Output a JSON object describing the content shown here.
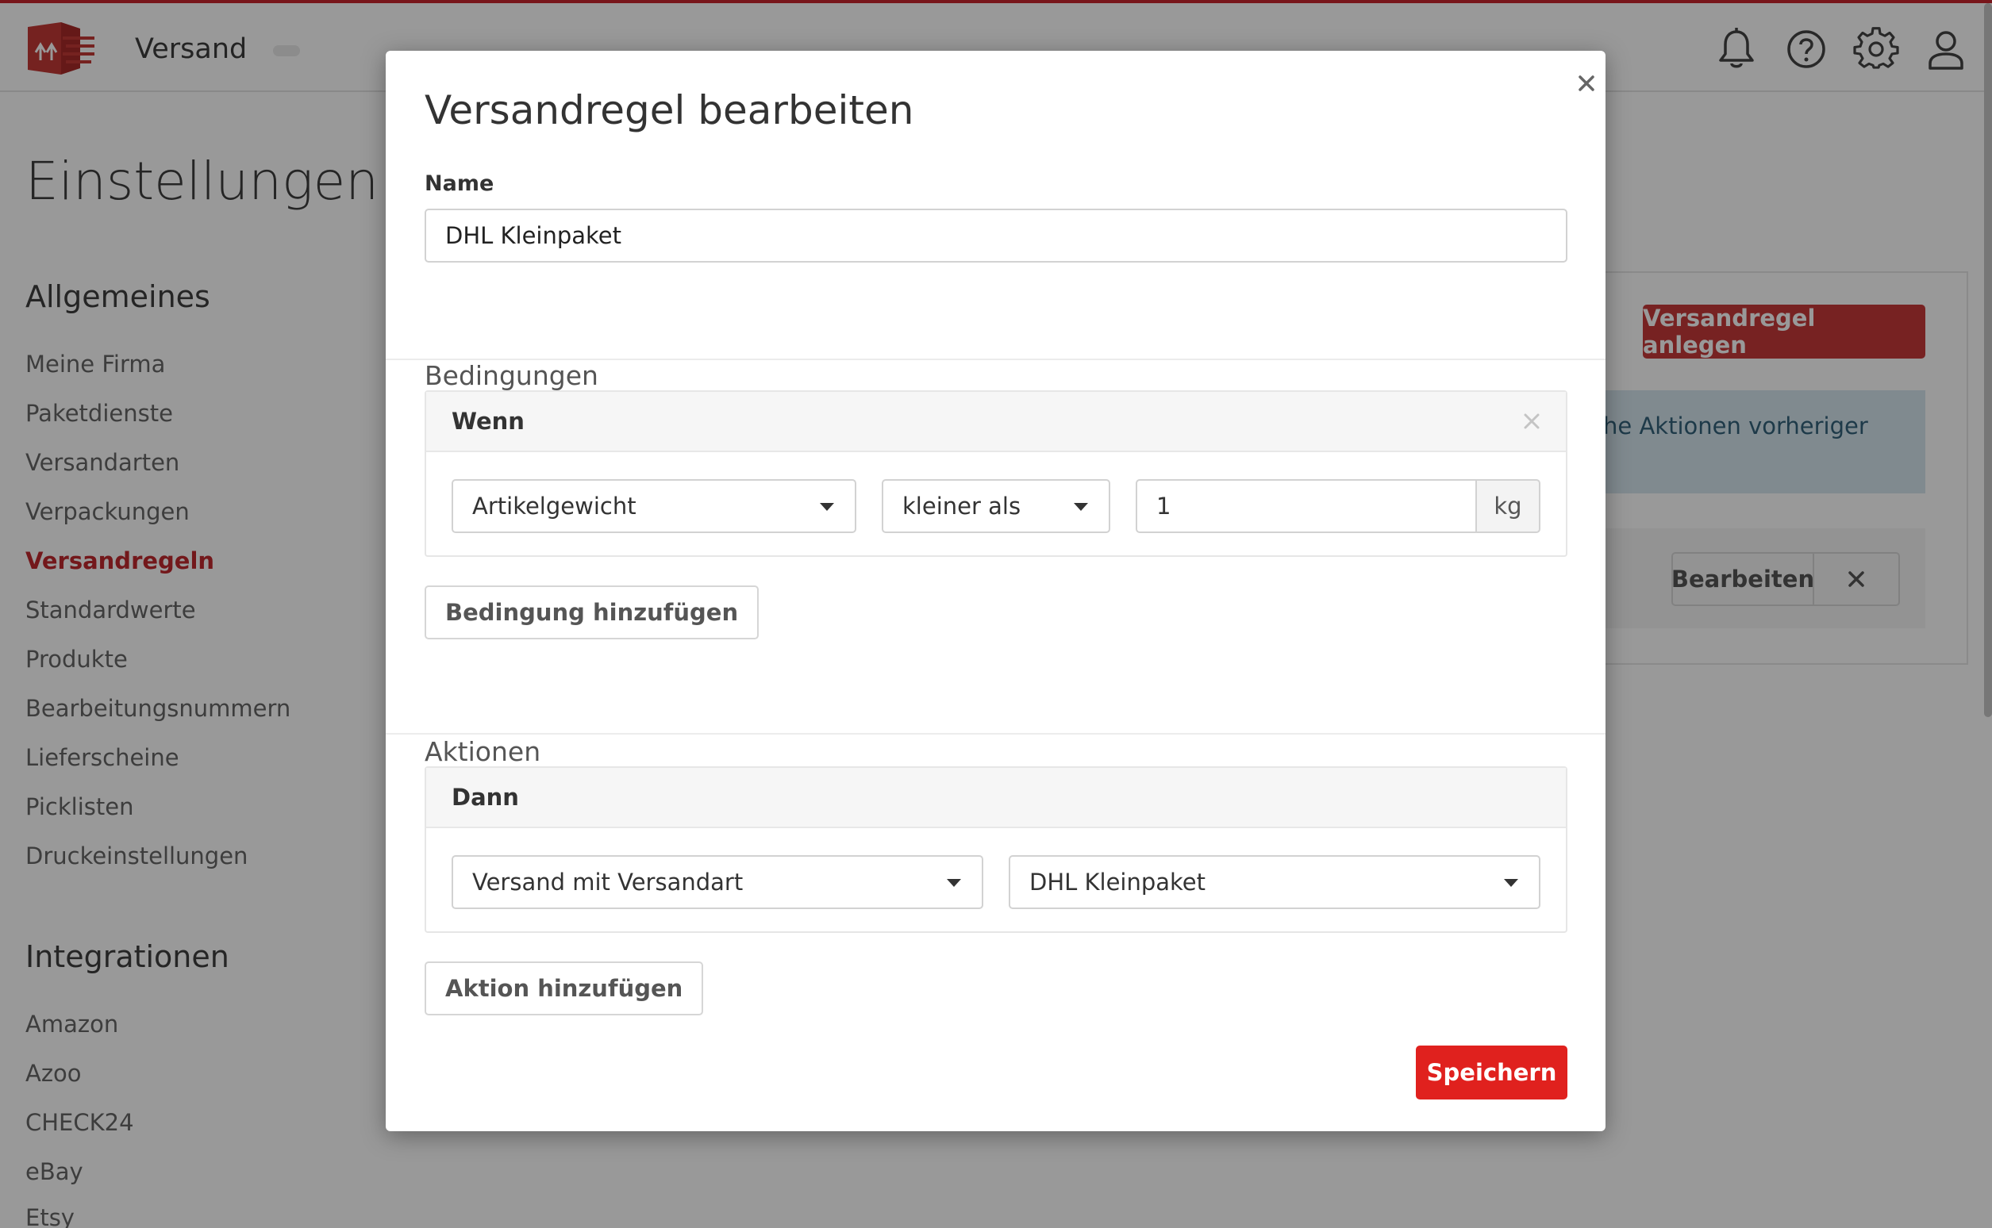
{
  "header": {
    "app_title": "Versand",
    "icons": [
      "bell-icon",
      "help-icon",
      "gear-icon",
      "user-icon"
    ]
  },
  "page": {
    "title": "Einstellungen"
  },
  "sidebar": {
    "general_title": "Allgemeines",
    "general_items": [
      {
        "label": "Meine Firma",
        "active": false
      },
      {
        "label": "Paketdienste",
        "active": false
      },
      {
        "label": "Versandarten",
        "active": false
      },
      {
        "label": "Verpackungen",
        "active": false
      },
      {
        "label": "Versandregeln",
        "active": true
      },
      {
        "label": "Standardwerte",
        "active": false
      },
      {
        "label": "Produkte",
        "active": false
      },
      {
        "label": "Bearbeitungsnummern",
        "active": false
      },
      {
        "label": "Lieferscheine",
        "active": false
      },
      {
        "label": "Picklisten",
        "active": false
      },
      {
        "label": "Druckeinstellungen",
        "active": false
      }
    ],
    "integrations_title": "Integrationen",
    "integration_items": [
      {
        "label": "Amazon"
      },
      {
        "label": "Azoo"
      },
      {
        "label": "CHECK24"
      },
      {
        "label": "eBay"
      },
      {
        "label": "Etsy"
      }
    ]
  },
  "content": {
    "create_button": "Versandregel anlegen",
    "info_text": "he Aktionen vorheriger",
    "edit_button": "Bearbeiten"
  },
  "modal": {
    "title": "Versandregel bearbeiten",
    "name_label": "Name",
    "name_value": "DHL Kleinpaket",
    "conditions_title": "Bedingungen",
    "condition_card": {
      "header": "Wenn",
      "field": "Artikelgewicht",
      "operator": "kleiner als",
      "value": "1",
      "unit": "kg"
    },
    "add_condition_button": "Bedingung hinzufügen",
    "actions_title": "Aktionen",
    "action_card": {
      "header": "Dann",
      "action": "Versand mit Versandart",
      "target": "DHL Kleinpaket"
    },
    "add_action_button": "Aktion hinzufügen",
    "save_button": "Speichern"
  },
  "colors": {
    "brand_red": "#c8262e",
    "primary_button": "#e0211e",
    "active_nav": "#c0282e",
    "info_bg": "#d5e6ef"
  }
}
